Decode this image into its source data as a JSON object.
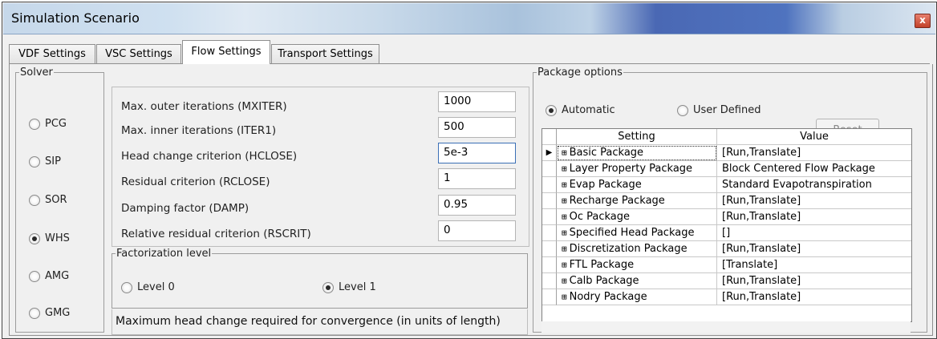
{
  "window": {
    "title": "Simulation Scenario",
    "close_glyph": "x"
  },
  "tabs": [
    {
      "label": "VDF Settings"
    },
    {
      "label": "VSC Settings"
    },
    {
      "label": "Flow Settings"
    },
    {
      "label": "Transport Settings"
    }
  ],
  "active_tab": "Flow Settings",
  "solver": {
    "legend": "Solver",
    "options": [
      {
        "label": "PCG",
        "selected": false
      },
      {
        "label": "SIP",
        "selected": false
      },
      {
        "label": "SOR",
        "selected": false
      },
      {
        "label": "WHS",
        "selected": true
      },
      {
        "label": "AMG",
        "selected": false
      },
      {
        "label": "GMG",
        "selected": false
      }
    ]
  },
  "parameters": [
    {
      "label": "Max. outer iterations (MXITER)",
      "value": "1000"
    },
    {
      "label": "Max. inner iterations (ITER1)",
      "value": "500"
    },
    {
      "label": "Head change criterion (HCLOSE)",
      "value": "5e-3"
    },
    {
      "label": "Residual criterion (RCLOSE)",
      "value": "1"
    },
    {
      "label": "Damping factor (DAMP)",
      "value": "0.95"
    },
    {
      "label": "Relative residual criterion (RSCRIT)",
      "value": "0"
    }
  ],
  "factorization": {
    "legend": "Factorization level",
    "options": [
      {
        "label": "Level 0",
        "selected": false
      },
      {
        "label": "Level 1",
        "selected": true
      }
    ]
  },
  "hint": "Maximum head change required for convergence (in units of length)",
  "package_options": {
    "legend": "Package options",
    "mode_options": [
      {
        "label": "Automatic",
        "selected": true
      },
      {
        "label": "User Defined",
        "selected": false
      }
    ],
    "reset_label": "Reset",
    "columns": [
      "Setting",
      "Value"
    ],
    "rows": [
      {
        "setting": "Basic Package",
        "value": "[Run,Translate]"
      },
      {
        "setting": "Layer Property Package",
        "value": "Block Centered Flow Package"
      },
      {
        "setting": "Evap Package",
        "value": "Standard Evapotranspiration"
      },
      {
        "setting": "Recharge Package",
        "value": "[Run,Translate]"
      },
      {
        "setting": "Oc Package",
        "value": "[Run,Translate]"
      },
      {
        "setting": "Specified Head Package",
        "value": "[]"
      },
      {
        "setting": "Discretization Package",
        "value": "[Run,Translate]"
      },
      {
        "setting": "FTL Package",
        "value": "[Translate]"
      },
      {
        "setting": "Calb Package",
        "value": "[Run,Translate]"
      },
      {
        "setting": "Nodry Package",
        "value": "[Run,Translate]"
      }
    ],
    "current_row_marker": "▶",
    "expander_glyph": "⊞"
  }
}
